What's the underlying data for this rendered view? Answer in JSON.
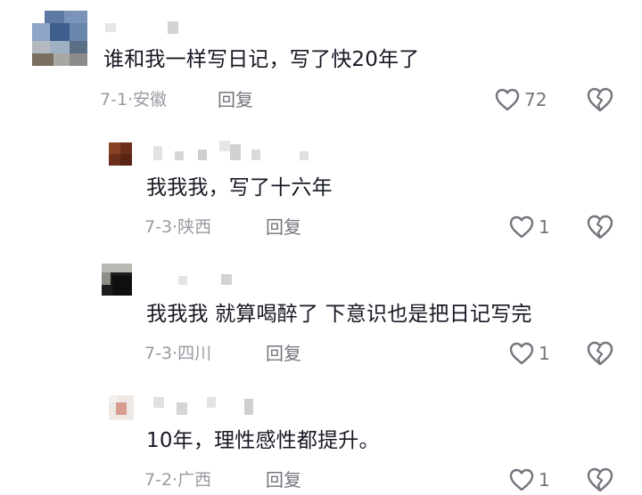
{
  "comments": [
    {
      "level": "root",
      "text": "谁和我一样写日记，写了快20年了",
      "date": "7-1",
      "location": "安徽",
      "reply_label": "回复",
      "likes": "72"
    },
    {
      "level": "reply",
      "text": "我我我，写了十六年",
      "date": "7-3",
      "location": "陕西",
      "reply_label": "回复",
      "likes": "1"
    },
    {
      "level": "reply",
      "text": "我我我 就算喝醉了 下意识也是把日记写完",
      "date": "7-3",
      "location": "四川",
      "reply_label": "回复",
      "likes": "1"
    },
    {
      "level": "reply",
      "text": "10年，理性感性都提升。",
      "date": "7-2",
      "location": "广西",
      "reply_label": "回复",
      "likes": "1"
    }
  ],
  "meta_separator": "·",
  "icons": {
    "like": "heart-outline-icon",
    "dislike": "broken-heart-icon"
  },
  "colors": {
    "text": "#161823",
    "meta": "#9a9ba3",
    "action": "#74757d",
    "background": "#ffffff"
  }
}
